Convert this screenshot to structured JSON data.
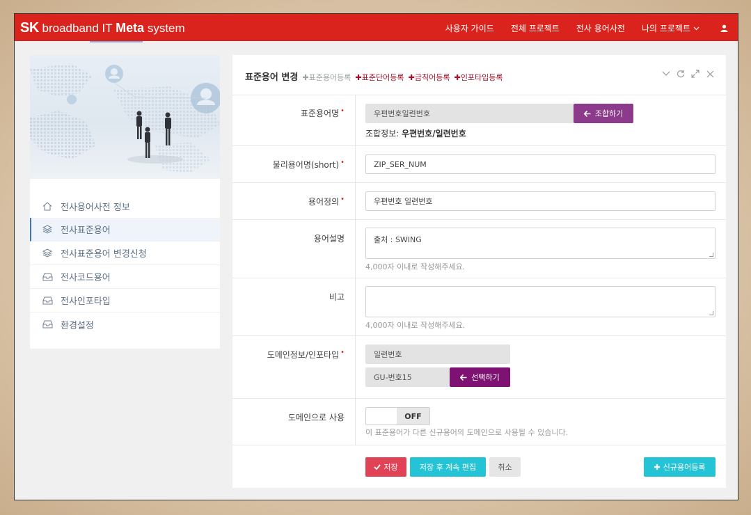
{
  "header": {
    "logo_sk": "SK",
    "logo_rest": " broadband IT ",
    "logo_meta": "Meta",
    "logo_system": " system",
    "nav": [
      "사용자 가이드",
      "전체 프로젝트",
      "전사 용어사전",
      "나의 프로젝트"
    ],
    "user_icon": "user-icon",
    "dropdown_icon": "chevron-down-icon"
  },
  "sidebar": {
    "items": [
      {
        "label": "전사용어사전 정보",
        "icon": "home-icon"
      },
      {
        "label": "전사표준용어",
        "icon": "layers-icon",
        "active": true
      },
      {
        "label": "전사표준용어 변경신청",
        "icon": "layers-icon"
      },
      {
        "label": "전사코드용어",
        "icon": "inbox-icon"
      },
      {
        "label": "전사인포타입",
        "icon": "inbox-icon"
      },
      {
        "label": "환경설정",
        "icon": "inbox-icon"
      }
    ]
  },
  "panel": {
    "title": "표준용어 변경",
    "links": [
      "표준용어등록",
      "표준단어등록",
      "금칙어등록",
      "인포타입등록"
    ],
    "tools": [
      "chevron-down-icon",
      "refresh-icon",
      "expand-icon",
      "close-icon"
    ]
  },
  "form": {
    "std_term": {
      "label": "표준용어명",
      "value": "우편번호일련번호",
      "button": "조합하기",
      "combo_label": "조합정보:",
      "combo_value": "우편번호/일련번호"
    },
    "phys_term": {
      "label": "물리용어명(short)",
      "value": "ZIP_SER_NUM"
    },
    "definition": {
      "label": "용어정의",
      "value": "우편번호 일련번호"
    },
    "description": {
      "label": "용어설명",
      "value": "출처 : SWING",
      "help": "4,000자 이내로 작성해주세요."
    },
    "remark": {
      "label": "비고",
      "value": "",
      "help": "4,000자 이내로 작성해주세요."
    },
    "domain": {
      "label": "도메인정보/인포타입",
      "value": "일련번호",
      "info_type": "GU-번호15",
      "button": "선택하기"
    },
    "use_as_domain": {
      "label": "도메인으로 사용",
      "toggle": "OFF",
      "help": "이 표준용어가 다른 신규용어의 도메인으로 사용될 수 있습니다."
    }
  },
  "actions": {
    "save": "저장",
    "save_continue": "저장 후 계속 편집",
    "cancel": "취소",
    "new_term": "신규용어등록"
  },
  "colors": {
    "topbar": "#d9231c",
    "purple": "#8e3a8c",
    "save": "#e04356",
    "cyan": "#25c3d6"
  }
}
